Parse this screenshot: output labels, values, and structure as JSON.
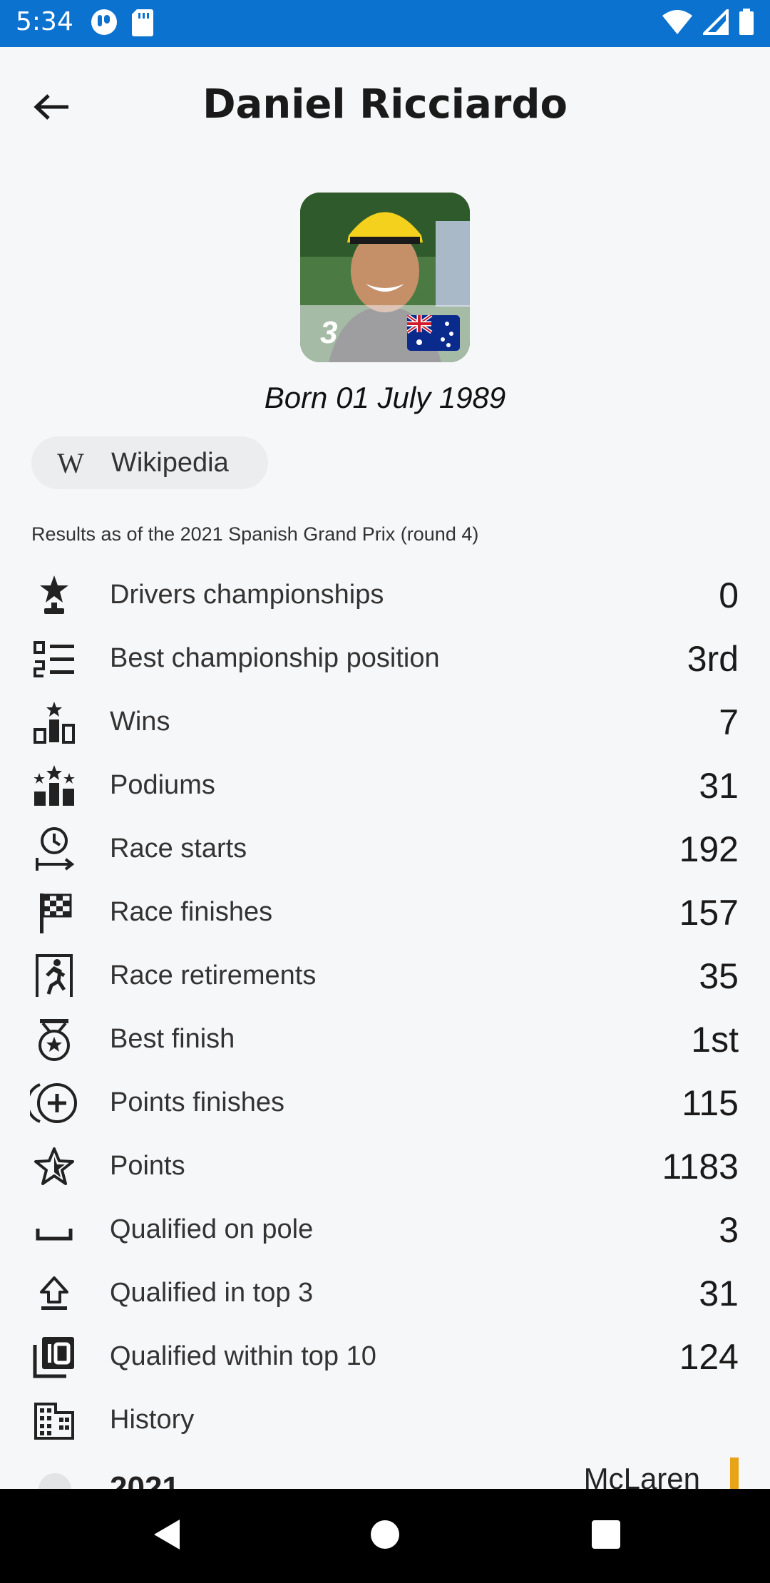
{
  "status_bar": {
    "time": "5:34",
    "left_icons": [
      "notification-app-icon",
      "sd-card-icon"
    ],
    "right_icons": [
      "wifi-icon",
      "signal-icon",
      "battery-icon"
    ],
    "color": "#0b72d0"
  },
  "header": {
    "title": "Daniel Ricciardo",
    "back_icon": "arrow-back-icon"
  },
  "profile": {
    "car_number": "3",
    "flag": "australia-flag",
    "born": "Born 01 July 1989",
    "wiki_label": "Wikipedia",
    "wiki_icon_glyph": "W"
  },
  "results_note": "Results as of the 2021 Spanish Grand Prix (round 4)",
  "stats": [
    {
      "icon": "trophy-star-icon",
      "label": "Drivers championships",
      "value": "0"
    },
    {
      "icon": "ranked-list-icon",
      "label": "Best championship position",
      "value": "3rd"
    },
    {
      "icon": "podium-star-icon",
      "label": "Wins",
      "value": "7"
    },
    {
      "icon": "podium-stars-icon",
      "label": "Podiums",
      "value": "31"
    },
    {
      "icon": "clock-start-icon",
      "label": "Race starts",
      "value": "192"
    },
    {
      "icon": "checkered-flag-icon",
      "label": "Race finishes",
      "value": "157"
    },
    {
      "icon": "exit-run-icon",
      "label": "Race retirements",
      "value": "35"
    },
    {
      "icon": "medal-icon",
      "label": "Best finish",
      "value": "1st"
    },
    {
      "icon": "circle-plus-icon",
      "label": "Points finishes",
      "value": "115"
    },
    {
      "icon": "star-outline-icon",
      "label": "Points",
      "value": "1183"
    },
    {
      "icon": "bracket-bottom-icon",
      "label": "Qualified on pole",
      "value": "3"
    },
    {
      "icon": "upload-arrow-icon",
      "label": "Qualified in top 3",
      "value": "31"
    },
    {
      "icon": "filter-10-icon",
      "label": "Qualified within top 10",
      "value": "124"
    },
    {
      "icon": "building-grid-icon",
      "label": "History",
      "value": ""
    }
  ],
  "history": {
    "year": "2021",
    "team": "McLaren",
    "team_color": "#e8a317"
  },
  "nav": {
    "back": "nav-back-icon",
    "home": "nav-home-icon",
    "recents": "nav-recents-icon"
  }
}
